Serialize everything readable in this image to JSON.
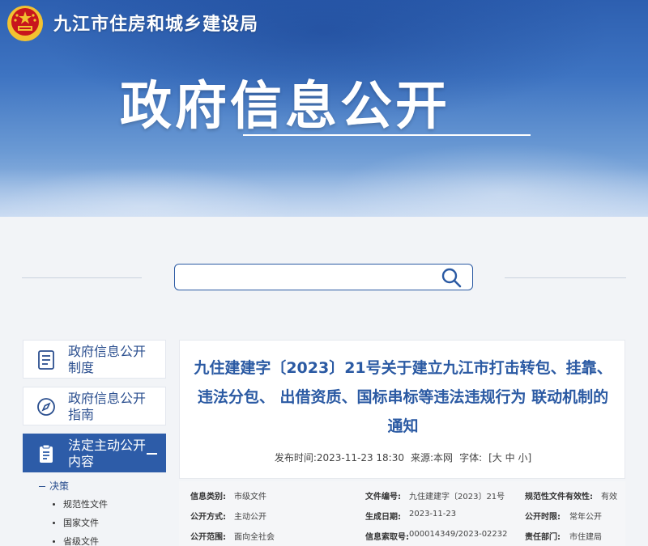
{
  "header": {
    "site_name": "九江市住房和城乡建设局",
    "hero_title": "政府信息公开"
  },
  "search": {
    "placeholder": "",
    "value": ""
  },
  "sidebar": {
    "items": [
      {
        "label": "政府信息公开制度",
        "icon": "document-list-icon"
      },
      {
        "label": "政府信息公开指南",
        "icon": "compass-icon"
      },
      {
        "label": "法定主动公开内容",
        "icon": "clipboard-icon",
        "active": true
      }
    ],
    "tree": {
      "head": "决策",
      "leaves": [
        "规范性文件",
        "国家文件",
        "省级文件"
      ]
    }
  },
  "article": {
    "title": "九住建建字〔2023〕21号关于建立九江市打击转包、挂靠、违法分包、 出借资质、国标串标等违法违规行为 联动机制的通知",
    "publish_label": "发布时间:",
    "publish_time": "2023-11-23 18:30",
    "source_label": "来源:",
    "source": "本网",
    "font_label": "字体:",
    "font_open": "[",
    "font_large": "大",
    "font_medium": "中",
    "font_small": "小",
    "font_close": "]"
  },
  "info": {
    "rows": [
      [
        {
          "k": "信息类别:",
          "v": "市级文件"
        },
        {
          "k": "文件编号:",
          "v": "九住建建字〔2023〕21号"
        },
        {
          "k": "规范性文件有效性:",
          "v": "有效"
        }
      ],
      [
        {
          "k": "公开方式:",
          "v": "主动公开"
        },
        {
          "k": "生成日期:",
          "v": "2023-11-23"
        },
        {
          "k": "公开时限:",
          "v": "常年公开"
        }
      ],
      [
        {
          "k": "公开范围:",
          "v": "面向全社会"
        },
        {
          "k": "信息索取号:",
          "v": "000014349/2023-02232"
        },
        {
          "k": "责任部门:",
          "v": "市住建局"
        }
      ]
    ]
  },
  "colors": {
    "brand_blue": "#2b5aa3",
    "active_blue": "#2d5ca8",
    "emblem_red": "#c8161d",
    "emblem_gold": "#f2c230"
  }
}
